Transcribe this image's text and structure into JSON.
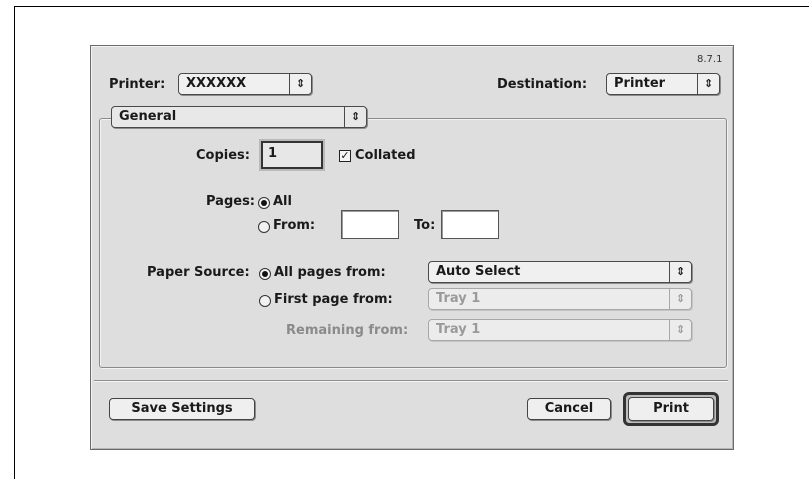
{
  "dialog": {
    "version": "8.7.1",
    "printer_label": "Printer:",
    "printer_value": "XXXXXX",
    "destination_label": "Destination:",
    "destination_value": "Printer",
    "panel_value": "General",
    "copies_label": "Copies:",
    "copies_value": "1",
    "collated_label": "Collated",
    "collated_checked": true,
    "pages_label": "Pages:",
    "all_label": "All",
    "from_label": "From:",
    "to_label": "To:",
    "from_value": "",
    "to_value": "",
    "paper_source_label": "Paper Source:",
    "all_pages_from_label": "All pages from:",
    "all_pages_from_value": "Auto Select",
    "first_page_from_label": "First page from:",
    "first_page_from_value": "Tray 1",
    "remaining_from_label": "Remaining from:",
    "remaining_from_value": "Tray 1",
    "save_settings_label": "Save Settings",
    "cancel_label": "Cancel",
    "print_label": "Print"
  },
  "icons": {
    "popup_arrows": "up-down-arrows-icon",
    "checkmark": "checkmark-icon"
  }
}
